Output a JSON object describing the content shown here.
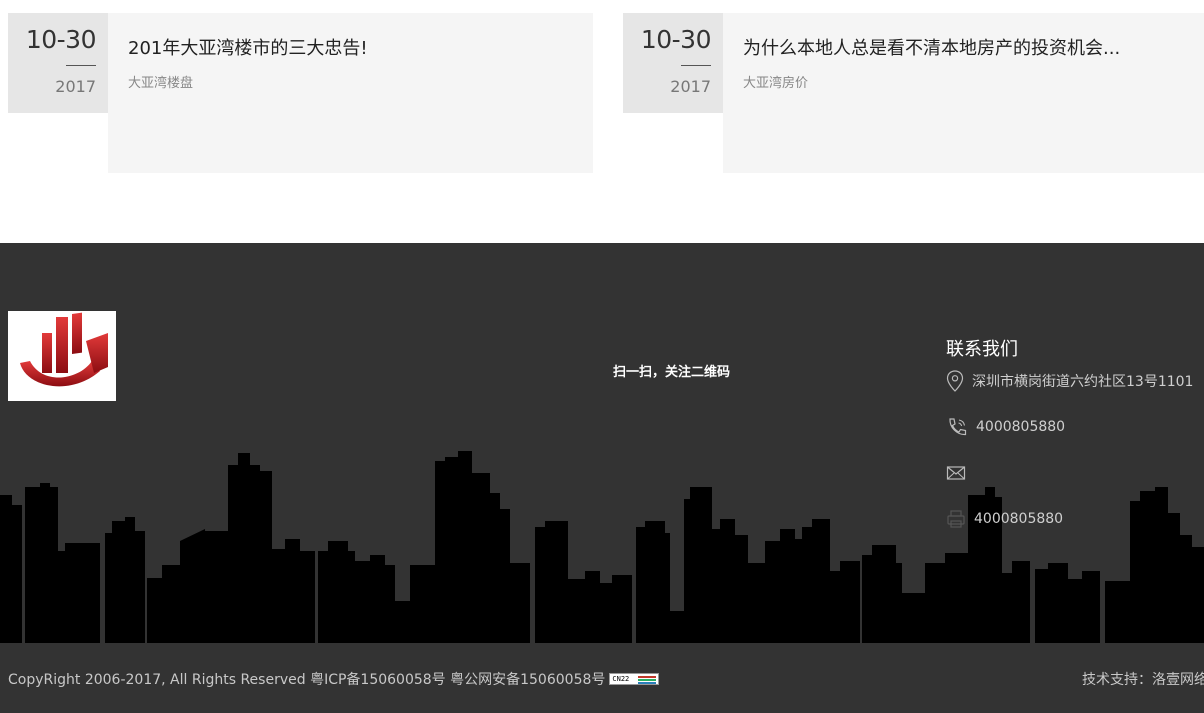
{
  "news": [
    {
      "date_md": "10-30",
      "year": "2017",
      "title": "201年大亚湾楼市的三大忠告!",
      "tag": "大亚湾楼盘"
    },
    {
      "date_md": "10-30",
      "year": "2017",
      "title": "为什么本地人总是看不清本地房产的投资机会...",
      "tag": "大亚湾房价"
    }
  ],
  "footer": {
    "qr_text": "扫一扫，关注二维码",
    "contact": {
      "title": "联系我们",
      "address": "深圳市横岗街道六约社区13号1101",
      "phone": "4000805880",
      "email": "",
      "fax": "4000805880"
    },
    "copyright": "CopyRight 2006-2017, All Rights Reserved 粤ICP备15060058号 粤公网安备15060058号",
    "badge": "CN22",
    "support": "技术支持：洛壹网络"
  },
  "colors": {
    "footer_bg": "#333333",
    "logo_red": "#c4141c",
    "skyline": "#000000"
  }
}
